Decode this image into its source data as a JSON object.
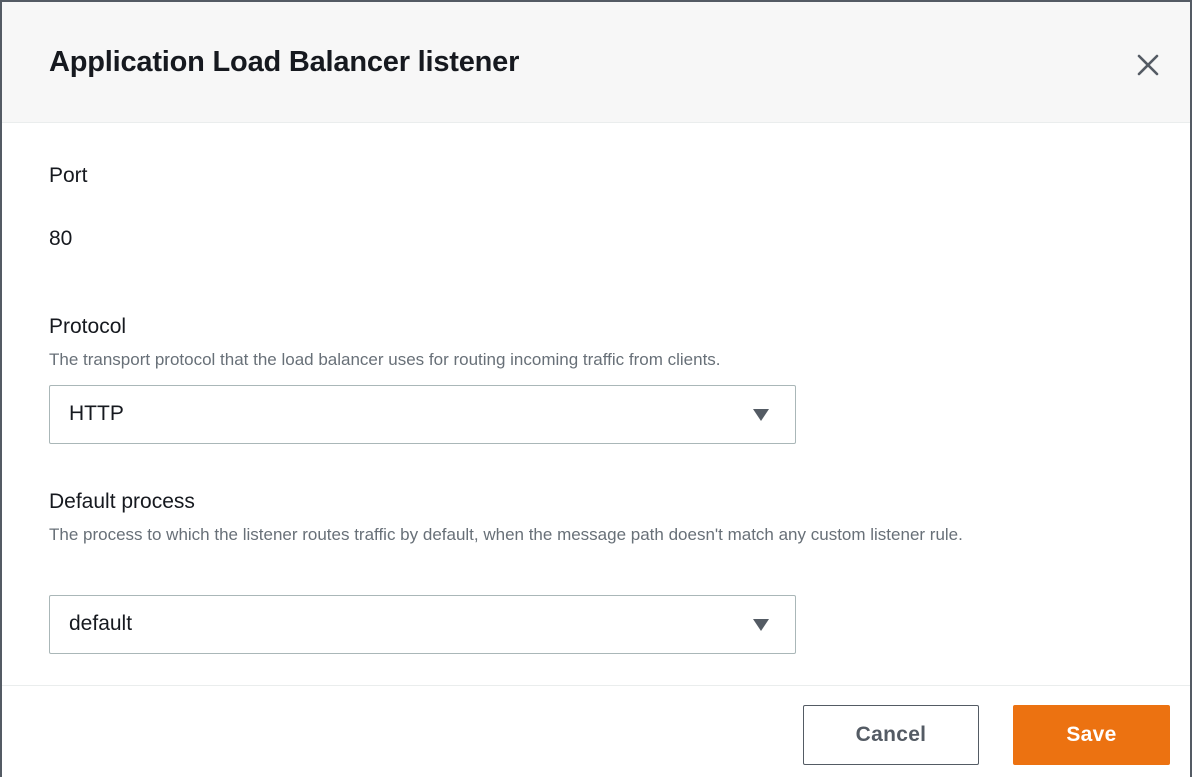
{
  "modal": {
    "title": "Application Load Balancer listener",
    "close_icon": "close-icon"
  },
  "port": {
    "label": "Port",
    "value": "80"
  },
  "protocol": {
    "label": "Protocol",
    "description": "The transport protocol that the load balancer uses for routing incoming traffic from clients.",
    "selected": "HTTP",
    "arrow_icon": "caret-down-icon"
  },
  "default_process": {
    "label": "Default process",
    "description": "The process to which the listener routes traffic by default, when the message path doesn't match any custom listener rule.",
    "selected": "default",
    "arrow_icon": "caret-down-icon"
  },
  "footer": {
    "cancel_label": "Cancel",
    "save_label": "Save"
  },
  "colors": {
    "primary": "#ec7211",
    "text": "#16191f",
    "secondary_text": "#687078",
    "header_bg": "#f7f7f7"
  }
}
